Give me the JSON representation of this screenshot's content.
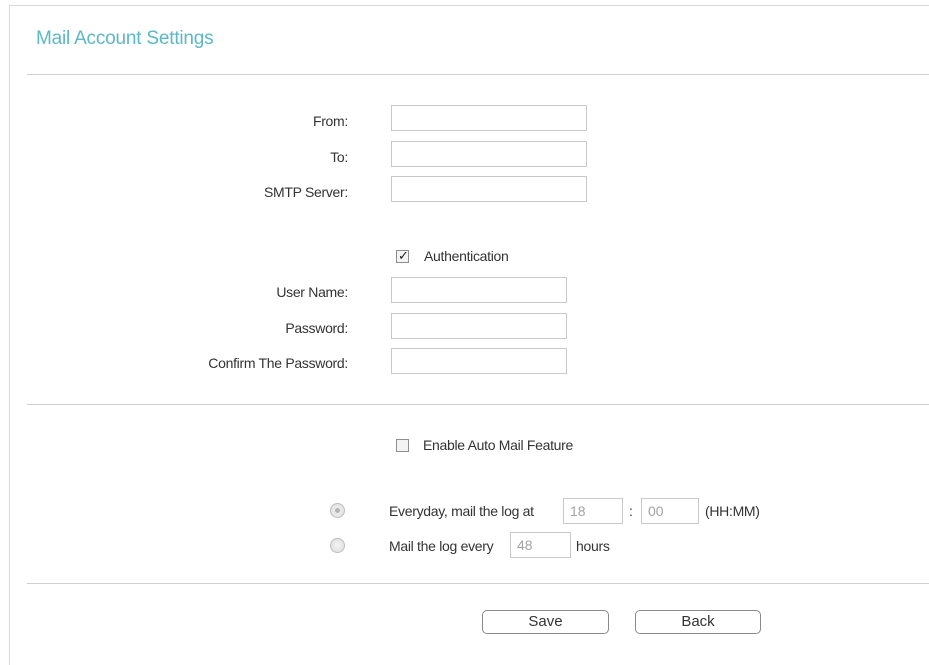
{
  "section": {
    "title": "Mail Account Settings"
  },
  "fields": {
    "from": {
      "label": "From:",
      "value": ""
    },
    "to": {
      "label": "To:",
      "value": ""
    },
    "smtp": {
      "label": "SMTP Server:",
      "value": ""
    },
    "username": {
      "label": "User Name:",
      "value": ""
    },
    "password": {
      "label": "Password:",
      "value": ""
    },
    "confirm_password": {
      "label": "Confirm The Password:",
      "value": ""
    }
  },
  "authentication": {
    "label": "Authentication",
    "checked": true
  },
  "auto_mail": {
    "label": "Enable Auto Mail Feature",
    "checked": false
  },
  "schedule": {
    "everyday": {
      "label": "Everyday, mail the log at",
      "hour": "18",
      "separator": ":",
      "minute": "00",
      "format": "(HH:MM)",
      "selected": true
    },
    "interval": {
      "label": "Mail the log every",
      "hours": "48",
      "unit": "hours",
      "selected": false
    }
  },
  "buttons": {
    "save": "Save",
    "back": "Back"
  },
  "icons": {
    "check": "checkmark-icon"
  }
}
